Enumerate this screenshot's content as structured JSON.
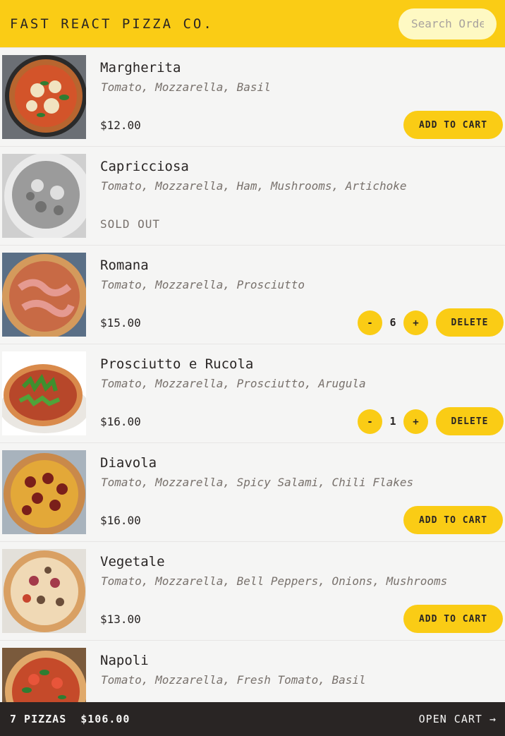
{
  "header": {
    "brand": "FAST REACT PIZZA CO.",
    "search_placeholder": "Search Order #"
  },
  "menu": [
    {
      "name": "Margherita",
      "ingredients": "Tomato, Mozzarella, Basil",
      "price": "$12.00",
      "action": "ADD TO CART",
      "image": "pizza-margherita-icon"
    },
    {
      "name": "Capricciosa",
      "ingredients": "Tomato, Mozzarella, Ham, Mushrooms, Artichoke",
      "status": "SOLD OUT",
      "image": "pizza-capricciosa-icon"
    },
    {
      "name": "Romana",
      "ingredients": "Tomato, Mozzarella, Prosciutto",
      "price": "$15.00",
      "quantity": "6",
      "decrease": "-",
      "increase": "+",
      "action": "DELETE",
      "image": "pizza-romana-icon"
    },
    {
      "name": "Prosciutto e Rucola",
      "ingredients": "Tomato, Mozzarella, Prosciutto, Arugula",
      "price": "$16.00",
      "quantity": "1",
      "decrease": "-",
      "increase": "+",
      "action": "DELETE",
      "image": "pizza-rucola-icon"
    },
    {
      "name": "Diavola",
      "ingredients": "Tomato, Mozzarella, Spicy Salami, Chili Flakes",
      "price": "$16.00",
      "action": "ADD TO CART",
      "image": "pizza-diavola-icon"
    },
    {
      "name": "Vegetale",
      "ingredients": "Tomato, Mozzarella, Bell Peppers, Onions, Mushrooms",
      "price": "$13.00",
      "action": "ADD TO CART",
      "image": "pizza-vegetale-icon"
    },
    {
      "name": "Napoli",
      "ingredients": "Tomato, Mozzarella, Fresh Tomato, Basil",
      "image": "pizza-napoli-icon"
    }
  ],
  "footer": {
    "count": "7 PIZZAS",
    "total": "$106.00",
    "open_cart": "OPEN CART →"
  },
  "colors": {
    "accent": "#facc15",
    "dark": "#292524",
    "background": "#f5f5f4",
    "muted": "#78716c"
  }
}
